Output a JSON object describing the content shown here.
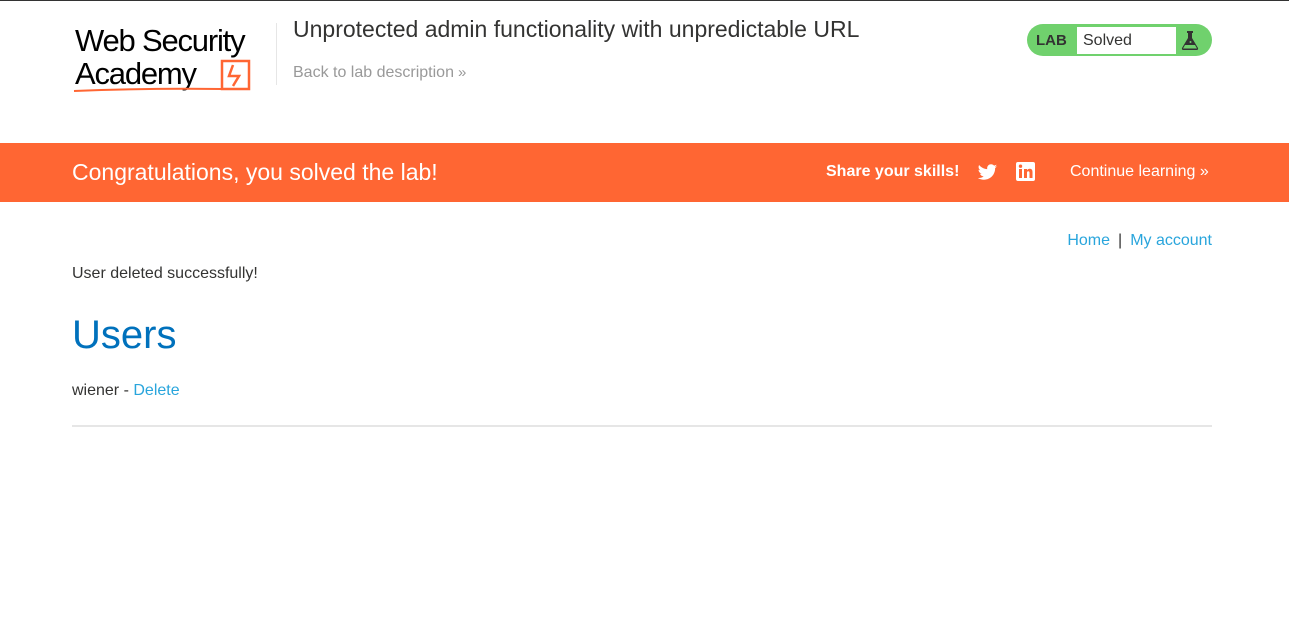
{
  "header": {
    "logo_text": [
      "Web Security",
      "Academy"
    ],
    "lab_title": "Unprotected admin functionality with unpredictable URL",
    "back_link": "Back to lab description",
    "lab_badge": {
      "label": "LAB",
      "status": "Solved",
      "icon": "flask-icon"
    }
  },
  "banner": {
    "message": "Congratulations, you solved the lab!",
    "share_label": "Share your skills!",
    "social_icons": [
      "twitter-icon",
      "linkedin-icon"
    ],
    "continue_label": "Continue learning"
  },
  "nav": {
    "home": "Home",
    "separator": "|",
    "my_account": "My account"
  },
  "main": {
    "status_message": "User deleted successfully!",
    "heading": "Users",
    "users": [
      {
        "name": "wiener",
        "separator": " - ",
        "action": "Delete"
      }
    ]
  },
  "colors": {
    "accent_orange": "#ff6633",
    "solved_green": "#70d16d",
    "link_blue": "#29a5dc",
    "heading_blue": "#0071bc"
  }
}
